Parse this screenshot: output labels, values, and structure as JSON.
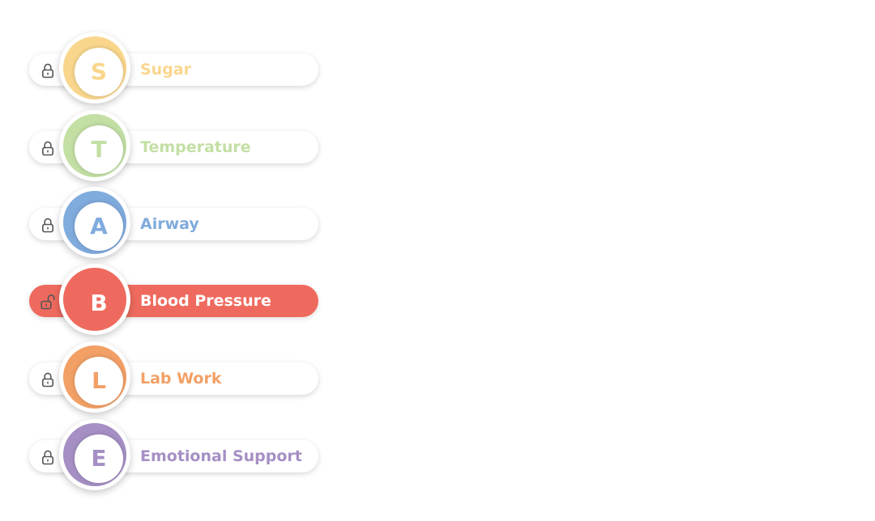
{
  "menu": {
    "items": [
      {
        "letter": "S",
        "label": "Sugar",
        "color": "#f9d68c",
        "locked": true,
        "active": false
      },
      {
        "letter": "T",
        "label": "Temperature",
        "color": "#c3dfa4",
        "locked": true,
        "active": false
      },
      {
        "letter": "A",
        "label": "Airway",
        "color": "#80abdd",
        "locked": true,
        "active": false
      },
      {
        "letter": "B",
        "label": "Blood Pressure",
        "color": "#ef6a5e",
        "locked": false,
        "active": true
      },
      {
        "letter": "L",
        "label": "Lab Work",
        "color": "#f2a066",
        "locked": true,
        "active": false
      },
      {
        "letter": "E",
        "label": "Emotional Support",
        "color": "#a58fc4",
        "locked": true,
        "active": false
      }
    ]
  }
}
